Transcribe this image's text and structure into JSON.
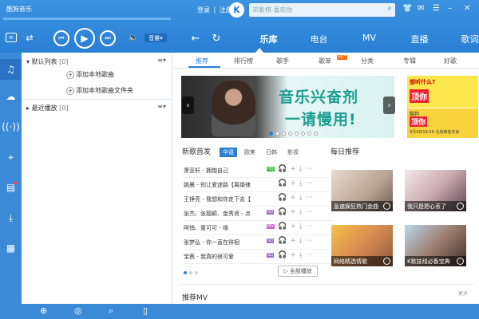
{
  "app": {
    "title": "酷狗音乐"
  },
  "player": {
    "progress": 0.0
  },
  "header": {
    "login": "登录",
    "separator": "|",
    "register": "注册",
    "logo_letter": "K",
    "search_placeholder": "邓紫棋 喜欢你",
    "nav_tabs": [
      {
        "label": "乐库",
        "active": true
      },
      {
        "label": "电台"
      },
      {
        "label": "MV"
      },
      {
        "label": "直播"
      },
      {
        "label": "歌词",
        "badge": true
      }
    ],
    "vol_label": "音量"
  },
  "playlist": {
    "default": {
      "label": "默认列表",
      "count": "[0]"
    },
    "add_song": "添加本地歌曲",
    "add_folder": "添加本地歌曲文件夹",
    "recent": {
      "label": "最近播放",
      "count": "[0]"
    }
  },
  "subtabs": [
    {
      "label": "推荐",
      "active": true
    },
    {
      "label": "排行榜"
    },
    {
      "label": "歌手"
    },
    {
      "label": "歌单",
      "hot": "HOT"
    },
    {
      "label": "分类"
    },
    {
      "label": "专辑"
    },
    {
      "label": "好歌"
    }
  ],
  "banner": {
    "line1": "音乐兴奋剂",
    "line2": "一请慢用!",
    "ad1_text": "想听什么?",
    "ad1_badge": "顶你",
    "ad2_text1": "酷狗",
    "ad2_text2": "顶你",
    "ad2_text3": "9月4日19:00 北京麻雀乐会"
  },
  "new_songs": {
    "title": "新歌首发",
    "filters": [
      "华语",
      "欧美",
      "日韩",
      "影视"
    ],
    "songs": [
      {
        "name": "萧亚轩 - 拥抱自己",
        "tag": "HQ"
      },
      {
        "name": "姚晨 - 别让爱迷路【离婚律",
        "tag": ""
      },
      {
        "name": "王铮亮 - 我想和你走下去【",
        "tag": ""
      },
      {
        "name": "张杰、张靓颖、金秀贤 - 点",
        "tag": "SQ"
      },
      {
        "name": "阿悄、童可可 - 缘",
        "tag": "MV"
      },
      {
        "name": "张梦弘 - 你一直在徘徊",
        "tag": "SQ"
      },
      {
        "name": "宝茜 - 我真的很可爱",
        "tag": "SQ"
      }
    ],
    "play_all": "全部播放"
  },
  "daily": {
    "title": "每日推荐",
    "items": [
      "急速娱狂热门金曲",
      "我只是把心丢了",
      "网络精选情歌",
      "K歌技线必备宝典"
    ]
  },
  "mv": {
    "title": "推荐MV",
    "more": "更多"
  },
  "colors": {
    "accent": "#2a7fd4",
    "topbar": "#3b92e0",
    "sidebar": "#3b8ad8"
  }
}
